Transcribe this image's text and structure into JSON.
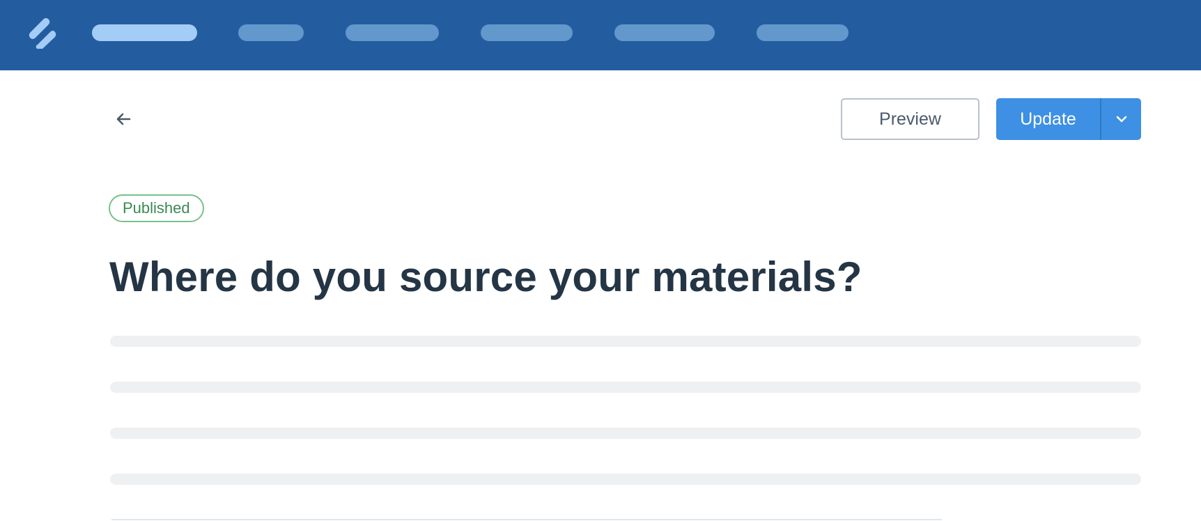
{
  "colors": {
    "topbar": "#235da0",
    "nav_active": "#a3cdf6",
    "nav_inactive": "#6298cc",
    "primary": "#3d90e3",
    "published": "#3a8a52",
    "title": "#243545"
  },
  "header": {
    "logo_icon": "double-slash-logo",
    "nav_items": [
      {
        "state": "active"
      },
      {
        "state": "inactive"
      },
      {
        "state": "inactive"
      },
      {
        "state": "inactive"
      },
      {
        "state": "inactive"
      },
      {
        "state": "inactive"
      }
    ]
  },
  "toolbar": {
    "back_icon": "arrow-left-icon",
    "preview_label": "Preview",
    "update_label": "Update",
    "dropdown_icon": "chevron-down-icon"
  },
  "article": {
    "status": "Published",
    "title": "Where do you source your materials?",
    "body_placeholder_lines": 4
  }
}
